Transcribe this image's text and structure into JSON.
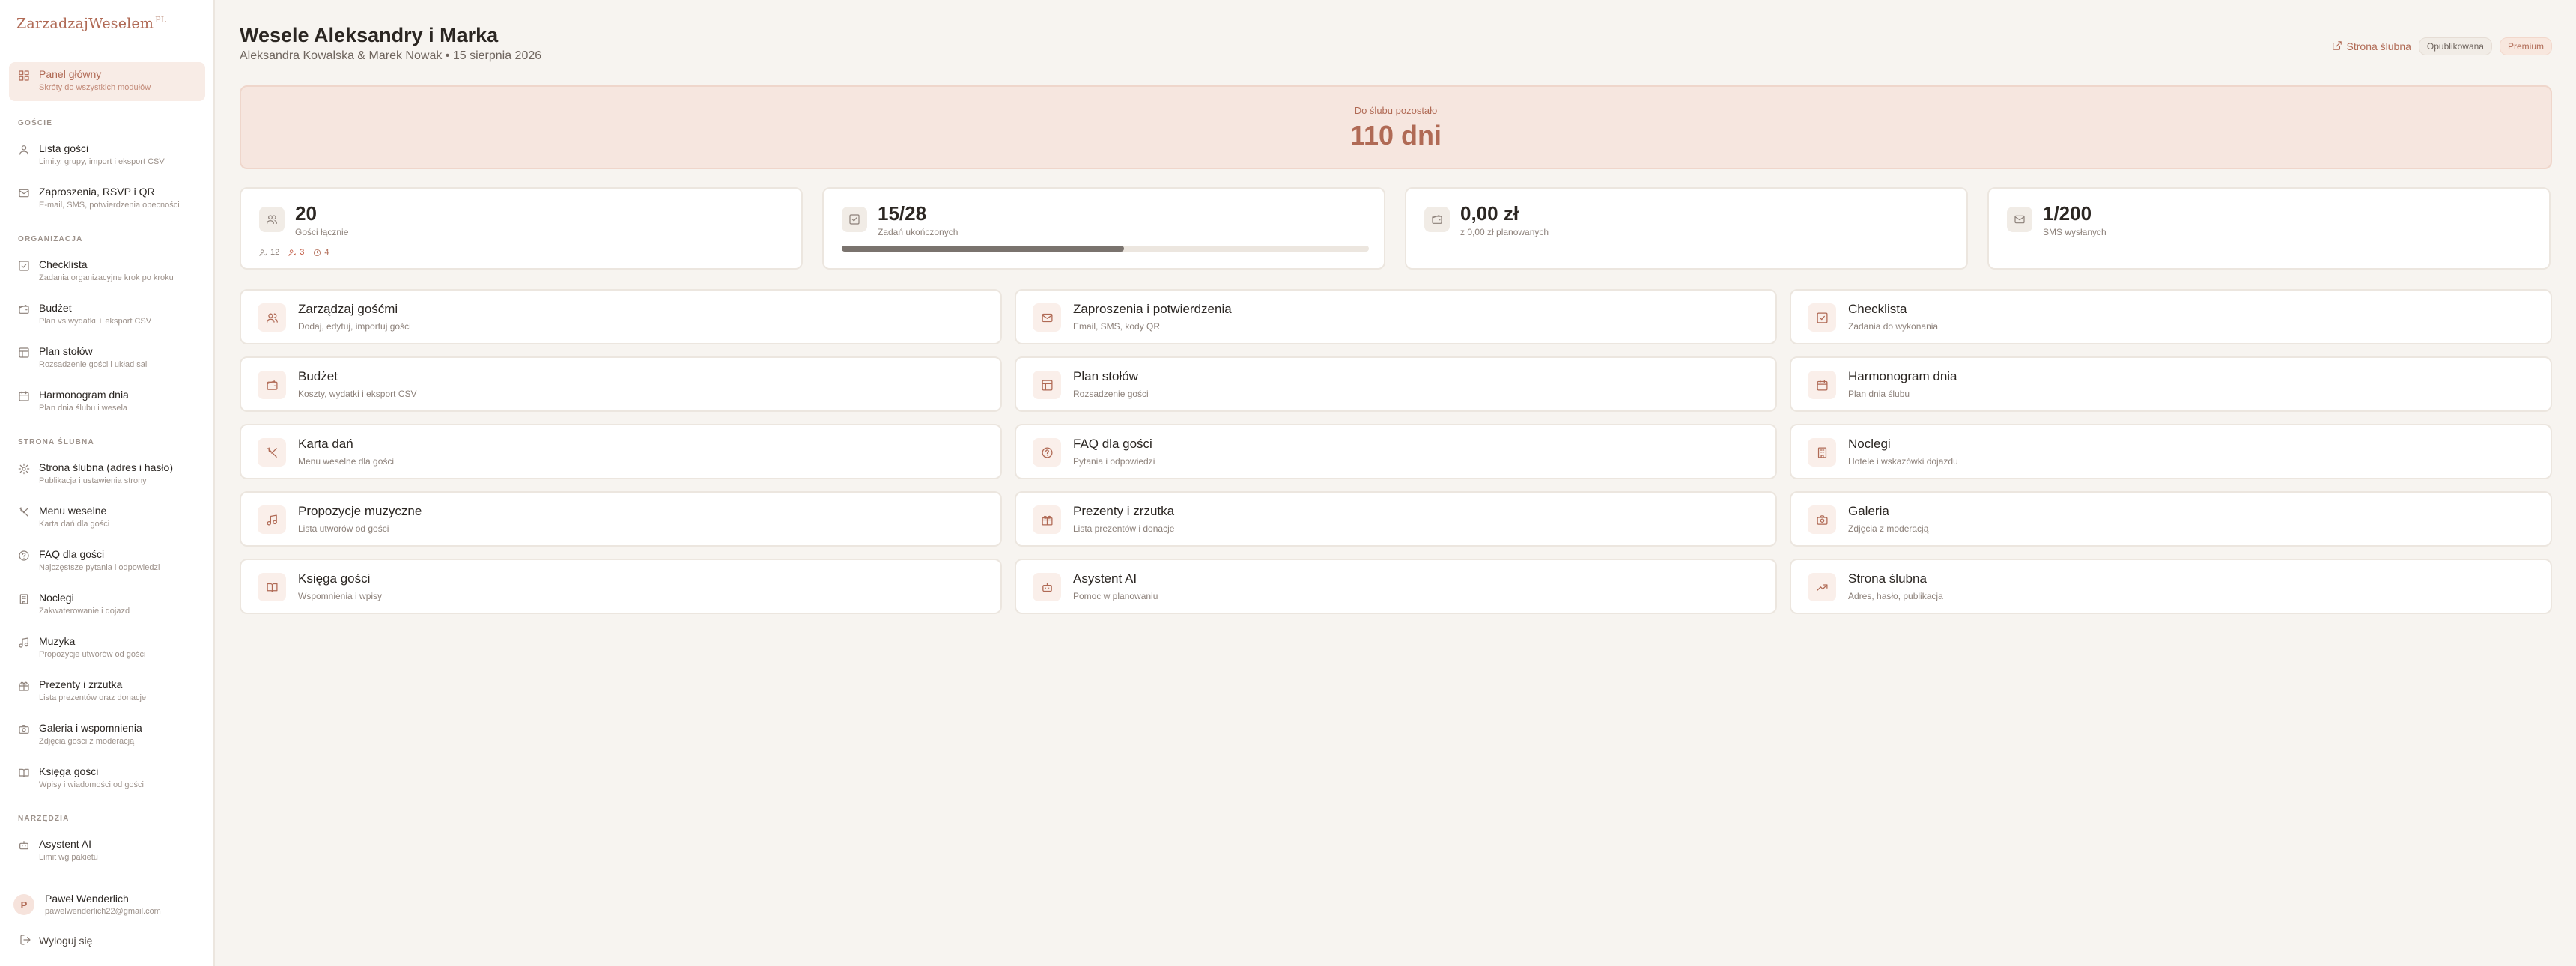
{
  "brand": {
    "name": "ZarzadzajWeselem",
    "suffix": "PL"
  },
  "sidebar": {
    "active": {
      "label": "Panel główny",
      "sub": "Skróty do wszystkich modułów"
    },
    "sections": [
      "Goście",
      "Organizacja",
      "Strona ślubna",
      "Narzędzia"
    ],
    "items": [
      {
        "label": "Lista gości",
        "sub": "Limity, grupy, import i eksport CSV"
      },
      {
        "label": "Zaproszenia, RSVP i QR",
        "sub": "E-mail, SMS, potwierdzenia obecności"
      },
      {
        "label": "Checklista",
        "sub": "Zadania organizacyjne krok po kroku"
      },
      {
        "label": "Budżet",
        "sub": "Plan vs wydatki + eksport CSV"
      },
      {
        "label": "Plan stołów",
        "sub": "Rozsadzenie gości i układ sali"
      },
      {
        "label": "Harmonogram dnia",
        "sub": "Plan dnia ślubu i wesela"
      },
      {
        "label": "Strona ślubna (adres i hasło)",
        "sub": "Publikacja i ustawienia strony"
      },
      {
        "label": "Menu weselne",
        "sub": "Karta dań dla gości"
      },
      {
        "label": "FAQ dla gości",
        "sub": "Najczęstsze pytania i odpowiedzi"
      },
      {
        "label": "Noclegi",
        "sub": "Zakwaterowanie i dojazd"
      },
      {
        "label": "Muzyka",
        "sub": "Propozycje utworów od gości"
      },
      {
        "label": "Prezenty i zrzutka",
        "sub": "Lista prezentów oraz donacje"
      },
      {
        "label": "Galeria i wspomnienia",
        "sub": "Zdjęcia gości z moderacją"
      },
      {
        "label": "Księga gości",
        "sub": "Wpisy i wiadomości od gości"
      },
      {
        "label": "Asystent AI",
        "sub": "Limit wg pakietu"
      }
    ],
    "user": {
      "initial": "P",
      "name": "Paweł Wenderlich",
      "email": "pawelwenderlich22@gmail.com"
    },
    "logout": "Wyloguj się"
  },
  "header": {
    "title": "Wesele Aleksandry i Marka",
    "subtitle": "Aleksandra Kowalska & Marek Nowak • 15 sierpnia 2026",
    "site_link": "Strona ślubna",
    "badge_status": "Opublikowana",
    "badge_plan": "Premium"
  },
  "countdown": {
    "label": "Do ślubu pozostało",
    "value": "110 dni"
  },
  "stats": {
    "guests": {
      "value": "20",
      "caption": "Gości łącznie",
      "accepted": "12",
      "declined": "3",
      "pending": "4"
    },
    "tasks": {
      "value": "15/28",
      "caption": "Zadań ukończonych",
      "progress": 0.536
    },
    "budget": {
      "value": "0,00 zł",
      "caption": "z 0,00 zł planowanych"
    },
    "sms": {
      "value": "1/200",
      "caption": "SMS wysłanych"
    }
  },
  "tiles": [
    {
      "title": "Zarządzaj gośćmi",
      "sub": "Dodaj, edytuj, importuj gości",
      "icon": "users-icon"
    },
    {
      "title": "Zaproszenia i potwierdzenia",
      "sub": "Email, SMS, kody QR",
      "icon": "mail-icon"
    },
    {
      "title": "Checklista",
      "sub": "Zadania do wykonania",
      "icon": "check-square-icon"
    },
    {
      "title": "Budżet",
      "sub": "Koszty, wydatki i eksport CSV",
      "icon": "wallet-icon"
    },
    {
      "title": "Plan stołów",
      "sub": "Rozsadzenie gości",
      "icon": "layout-icon"
    },
    {
      "title": "Harmonogram dnia",
      "sub": "Plan dnia ślubu",
      "icon": "calendar-icon"
    },
    {
      "title": "Karta dań",
      "sub": "Menu weselne dla gości",
      "icon": "utensils-icon"
    },
    {
      "title": "FAQ dla gości",
      "sub": "Pytania i odpowiedzi",
      "icon": "help-circle-icon"
    },
    {
      "title": "Noclegi",
      "sub": "Hotele i wskazówki dojazdu",
      "icon": "building-icon"
    },
    {
      "title": "Propozycje muzyczne",
      "sub": "Lista utworów od gości",
      "icon": "music-icon"
    },
    {
      "title": "Prezenty i zrzutka",
      "sub": "Lista prezentów i donacje",
      "icon": "gift-icon"
    },
    {
      "title": "Galeria",
      "sub": "Zdjęcia z moderacją",
      "icon": "camera-icon"
    },
    {
      "title": "Księga gości",
      "sub": "Wspomnienia i wpisy",
      "icon": "book-icon"
    },
    {
      "title": "Asystent AI",
      "sub": "Pomoc w planowaniu",
      "icon": "bot-icon"
    },
    {
      "title": "Strona ślubna",
      "sub": "Adres, hasło, publikacja",
      "icon": "trending-up-icon"
    }
  ],
  "colors": {
    "accent": "#b06a55",
    "background": "#f7f4f0",
    "countdown_bg": "#f6e6df"
  }
}
